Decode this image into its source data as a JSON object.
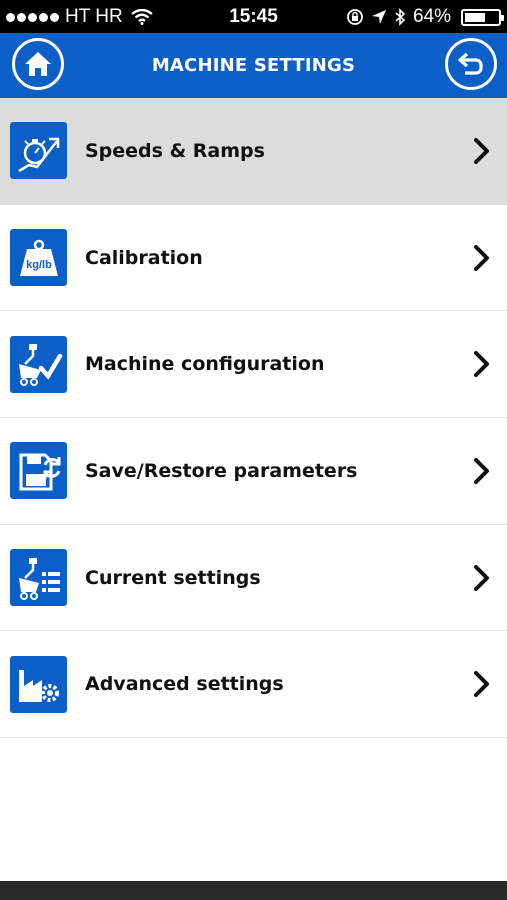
{
  "status_bar": {
    "carrier": "HT HR",
    "time": "15:45",
    "battery": "64%",
    "battery_level": 0.64,
    "icons": [
      "signal-dots-icon",
      "wifi-icon",
      "orientation-lock-icon",
      "location-icon",
      "bluetooth-icon",
      "battery-icon"
    ]
  },
  "header": {
    "title": "MACHINE SETTINGS",
    "home_icon": "home-icon",
    "back_icon": "back-icon"
  },
  "menu": {
    "items": [
      {
        "label": "Speeds & Ramps",
        "icon": "stopwatch-icon",
        "selected": true
      },
      {
        "label": "Calibration",
        "icon": "weight-icon",
        "icon_text": "kg/lb",
        "selected": false
      },
      {
        "label": "Machine configuration",
        "icon": "machine-check-icon",
        "selected": false
      },
      {
        "label": "Save/Restore parameters",
        "icon": "floppy-restore-icon",
        "selected": false
      },
      {
        "label": "Current settings",
        "icon": "machine-list-icon",
        "selected": false
      },
      {
        "label": "Advanced settings",
        "icon": "factory-gear-icon",
        "selected": false
      }
    ]
  },
  "colors": {
    "accent": "#0b5fc7",
    "selected_row": "#dcdcdc",
    "status_bar": "#000000"
  }
}
